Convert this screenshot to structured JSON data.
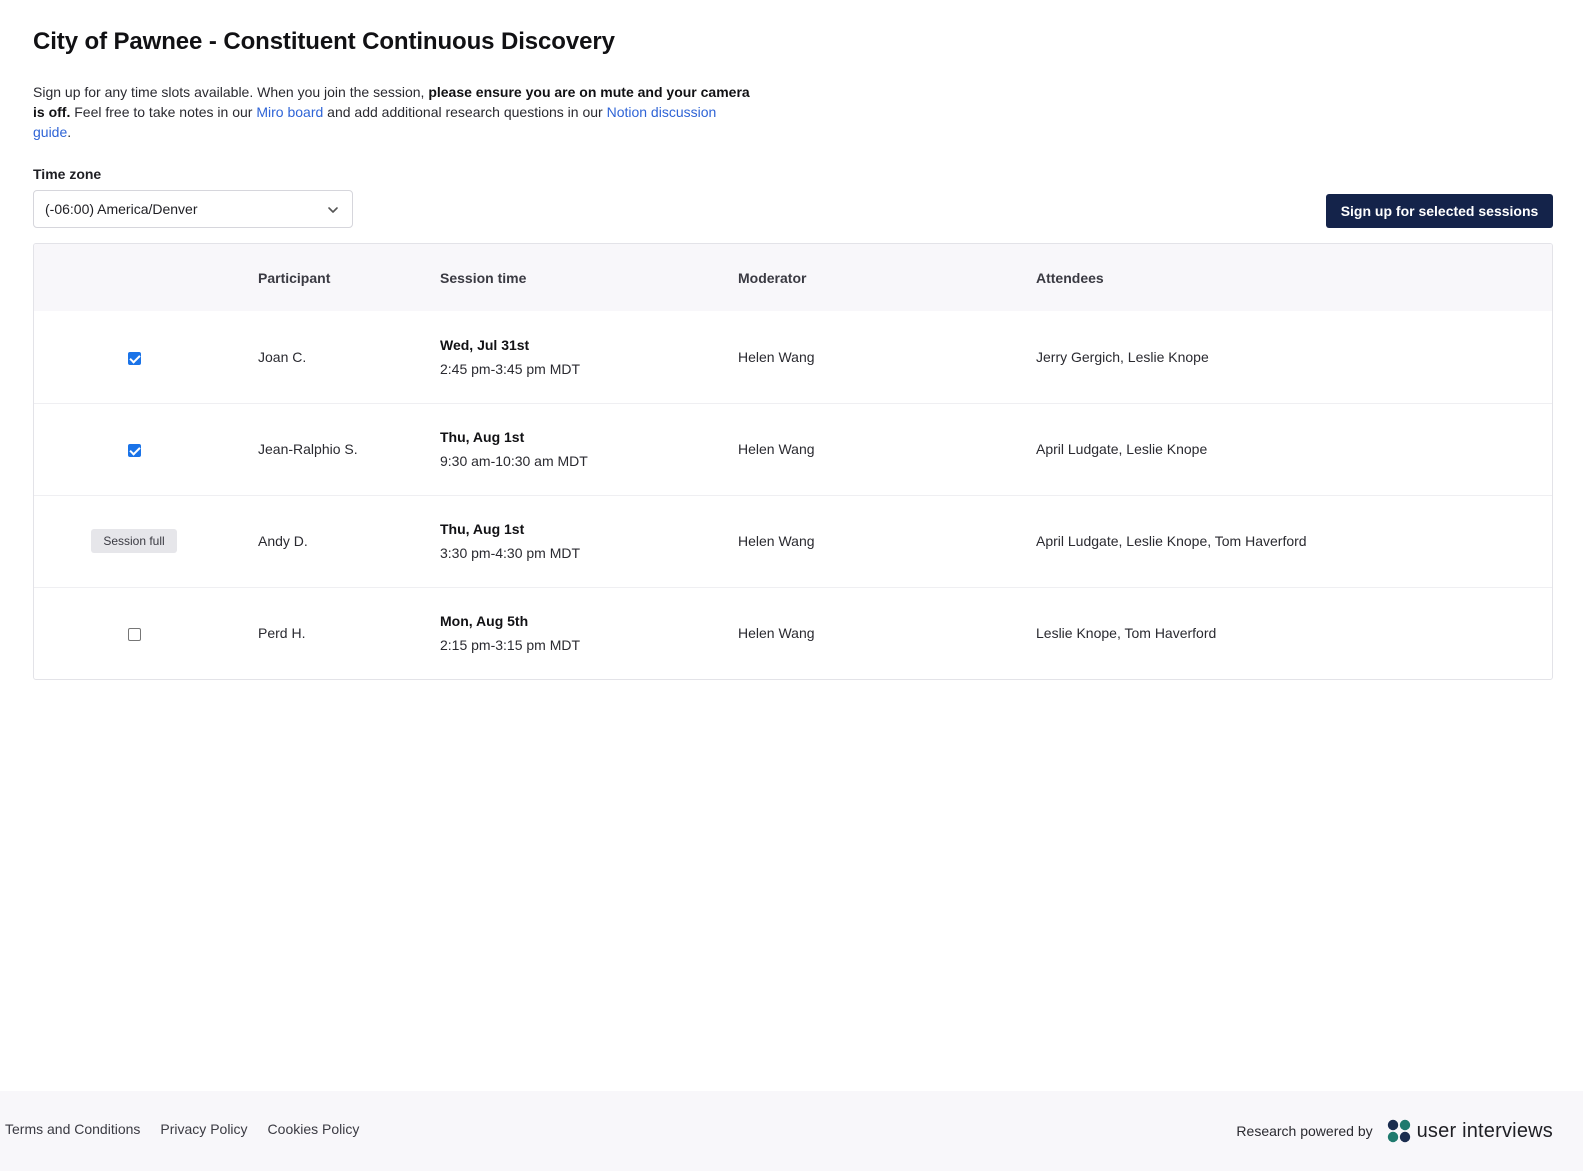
{
  "header": {
    "title": "City of Pawnee - Constituent Continuous Discovery"
  },
  "intro": {
    "part1": "Sign up for any time slots available. When you join the session, ",
    "bold": "please ensure you are on mute and your camera is off.",
    "part2": " Feel free to take notes in our ",
    "link_miro": "Miro board",
    "part3": " and add additional research questions in our ",
    "link_notion": "Notion discussion guide",
    "part4": "."
  },
  "timezone": {
    "label": "Time zone",
    "selected": "(-06:00) America/Denver"
  },
  "actions": {
    "signup_label": "Sign up for selected sessions"
  },
  "table": {
    "columns": [
      "",
      "Participant",
      "Session time",
      "Moderator",
      "Attendees"
    ],
    "rows": [
      {
        "selection": "checked",
        "participant": "Joan C.",
        "date": "Wed, Jul 31st",
        "time": "2:45 pm-3:45 pm MDT",
        "moderator": "Helen Wang",
        "attendees": "Jerry Gergich, Leslie Knope"
      },
      {
        "selection": "checked",
        "participant": "Jean-Ralphio S.",
        "date": "Thu, Aug 1st",
        "time": "9:30 am-10:30 am MDT",
        "moderator": "Helen Wang",
        "attendees": "April Ludgate, Leslie Knope"
      },
      {
        "selection": "full",
        "full_label": "Session full",
        "participant": "Andy D.",
        "date": "Thu, Aug 1st",
        "time": "3:30 pm-4:30 pm MDT",
        "moderator": "Helen Wang",
        "attendees": "April Ludgate, Leslie Knope, Tom Haverford"
      },
      {
        "selection": "unchecked",
        "participant": "Perd H.",
        "date": "Mon, Aug 5th",
        "time": "2:15 pm-3:15 pm MDT",
        "moderator": "Helen Wang",
        "attendees": "Leslie Knope, Tom Haverford"
      }
    ]
  },
  "footer": {
    "links": [
      "Terms and Conditions",
      "Privacy Policy",
      "Cookies Policy"
    ],
    "powered_by": "Research powered by",
    "brand": "user interviews",
    "brand_logo_icon": "user-interviews-logo-icon"
  },
  "colors": {
    "primary_button": "#14234a",
    "link": "#2f64d6",
    "checkbox": "#1a73e8",
    "table_header_bg": "#f8f7fa",
    "footer_bg": "#f8f7fa",
    "logo_dark": "#1b2d4f",
    "logo_teal": "#1f7a6e"
  }
}
